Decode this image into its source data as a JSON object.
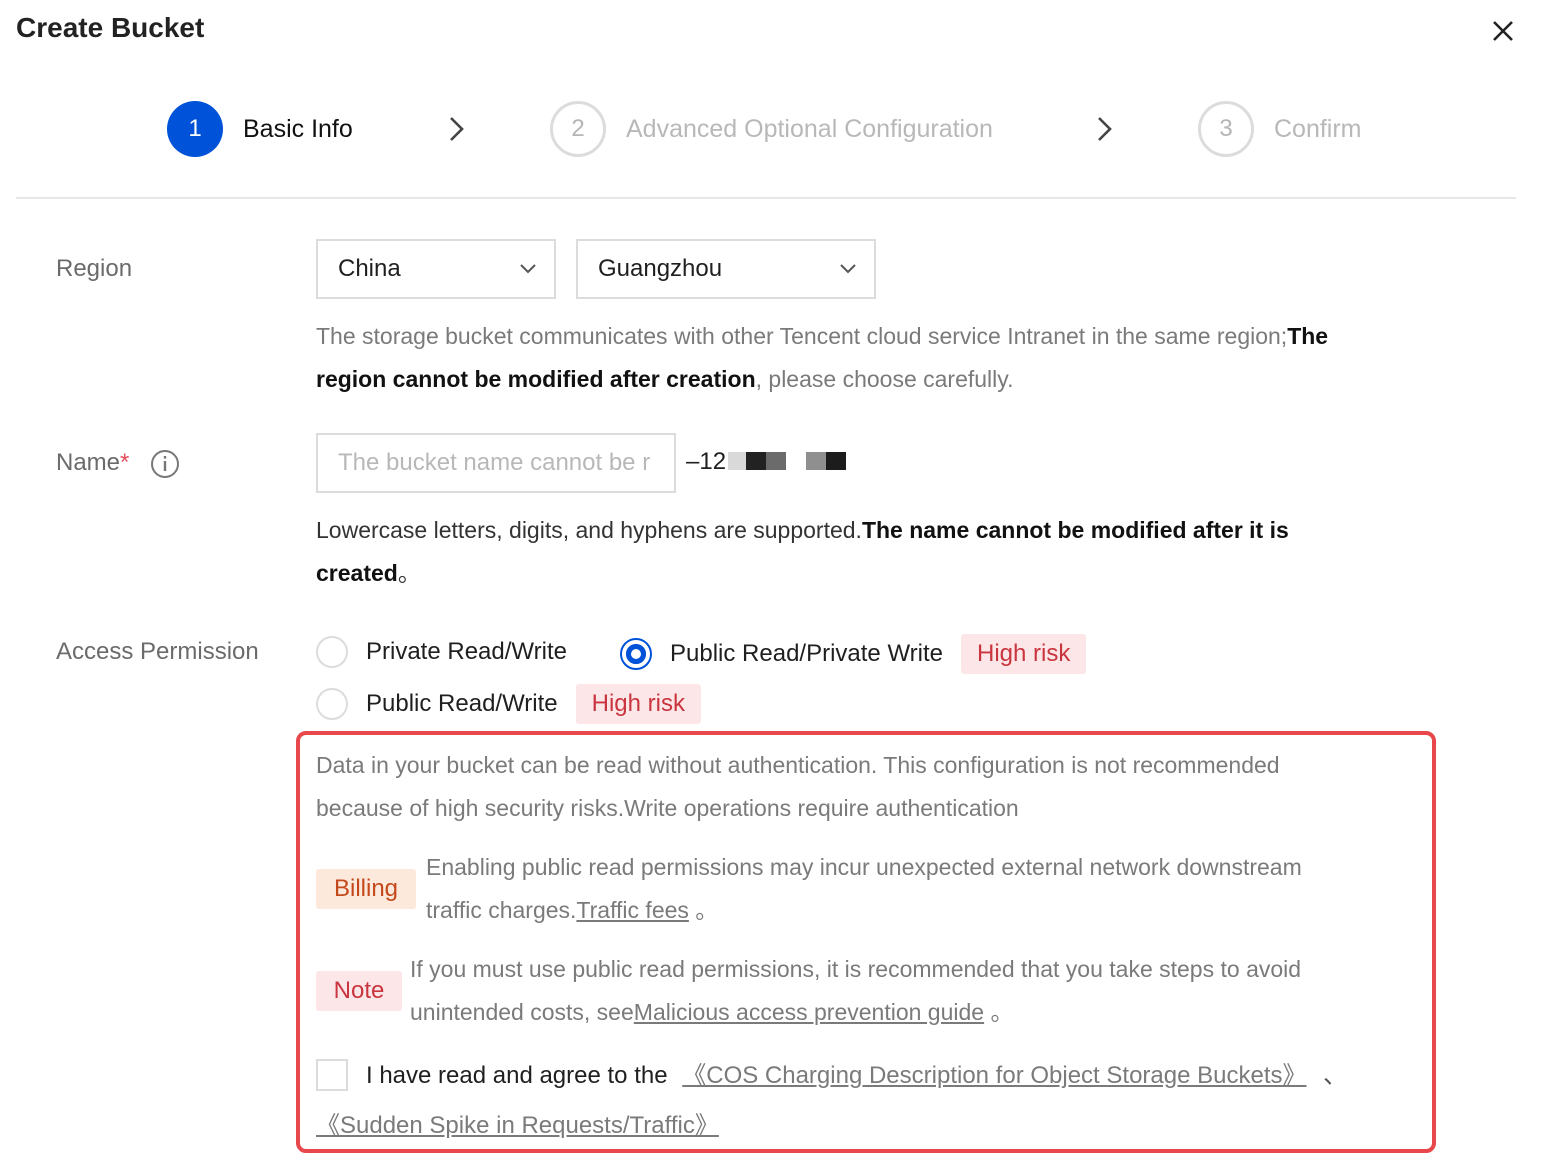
{
  "dialog": {
    "title": "Create Bucket",
    "close_icon": "close-icon"
  },
  "steps": [
    {
      "number": "1",
      "label": "Basic Info",
      "state": "active"
    },
    {
      "number": "2",
      "label": "Advanced Optional Configuration",
      "state": "inactive"
    },
    {
      "number": "3",
      "label": "Confirm",
      "state": "inactive"
    }
  ],
  "region": {
    "label": "Region",
    "country_value": "China",
    "city_value": "Guangzhou",
    "help_text_1": "The storage bucket communicates with other Tencent cloud service Intranet in the same region;",
    "help_bold_a": "The",
    "help_bold_b": "region cannot be modified after creation",
    "help_text_2": ", please choose carefully."
  },
  "name": {
    "label": "Name",
    "required_mark": "*",
    "info_icon": "info-icon",
    "placeholder": "The bucket name cannot be r",
    "suffix": "–12",
    "help_text": "Lowercase letters, digits, and hyphens are supported.",
    "help_bold_a": "The name cannot be modified after it is",
    "help_bold_b": "created",
    "help_end": "。"
  },
  "access": {
    "label": "Access Permission",
    "options": [
      {
        "label": "Private Read/Write",
        "checked": false
      },
      {
        "label": "Public Read/Private Write",
        "checked": true,
        "badge": "High risk"
      },
      {
        "label": "Public Read/Write",
        "checked": false,
        "badge": "High risk"
      }
    ]
  },
  "warning": {
    "desc_line1": "Data in your bucket can be read without authentication. This configuration is not recommended",
    "desc_line2": "because of high security risks.Write operations require authentication",
    "billing_tag": "Billing",
    "billing_line1": "Enabling public read permissions may incur unexpected external network downstream",
    "billing_line2": "traffic charges.",
    "billing_link": "Traffic fees",
    "billing_end": " 。",
    "note_tag": "Note",
    "note_line1": "If you must use public read permissions, it is recommended that you take steps to avoid",
    "note_line2": "unintended costs, see",
    "note_link": "Malicious access prevention guide",
    "note_end": " 。",
    "agree_text": "I have read and agree to the",
    "agree_link_1": "《COS Charging Description for Object Storage Buckets》",
    "agree_sep": "、",
    "agree_link_2": "《Sudden Spike in Requests/Traffic》",
    "agree_checked": false
  },
  "colors": {
    "primary": "#0052d9",
    "risk_bg": "#fde6e7",
    "risk_text": "#c9353f",
    "billing_bg": "#fde9dc",
    "billing_text": "#c4481a",
    "highlight_border": "#e8474c"
  }
}
